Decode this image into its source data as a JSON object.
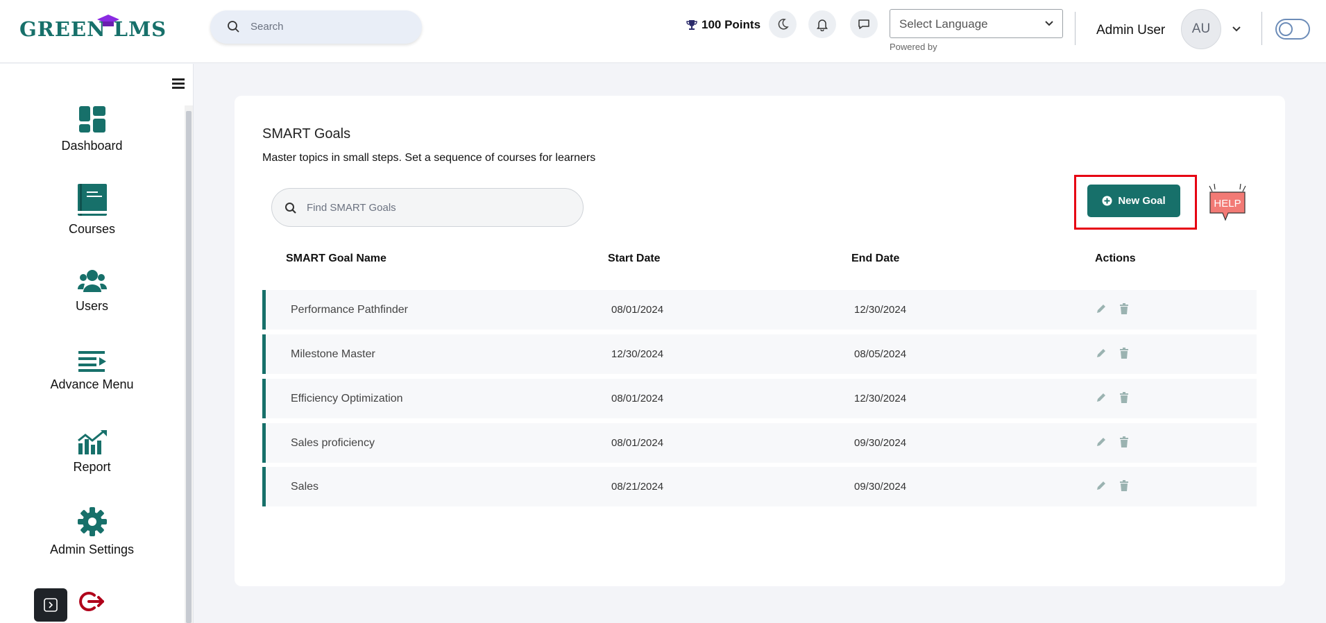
{
  "header": {
    "logo_text": "GREEN LMS",
    "search_placeholder": "Search",
    "points": "100 Points",
    "language_placeholder": "Select Language",
    "powered_by": "Powered by",
    "user_name": "Admin User",
    "avatar_initials": "AU"
  },
  "sidebar": {
    "items": [
      {
        "label": "Dashboard",
        "icon": "dashboard-icon"
      },
      {
        "label": "Courses",
        "icon": "book-icon"
      },
      {
        "label": "Users",
        "icon": "users-icon"
      },
      {
        "label": "Advance Menu",
        "icon": "menu-arrow-icon"
      },
      {
        "label": "Report",
        "icon": "chart-icon"
      },
      {
        "label": "Admin Settings",
        "icon": "gear-icon"
      }
    ]
  },
  "main": {
    "title": "SMART Goals",
    "subtitle": "Master topics in small steps. Set a sequence of courses for learners",
    "find_placeholder": "Find SMART Goals",
    "new_goal_label": "New Goal",
    "help_label": "HELP",
    "columns": [
      "SMART Goal Name",
      "Start Date",
      "End Date",
      "Actions"
    ],
    "rows": [
      {
        "name": "Performance Pathfinder",
        "start": "08/01/2024",
        "end": "12/30/2024"
      },
      {
        "name": "Milestone Master",
        "start": "12/30/2024",
        "end": "08/05/2024"
      },
      {
        "name": "Efficiency Optimization",
        "start": "08/01/2024",
        "end": "12/30/2024"
      },
      {
        "name": "Sales proficiency",
        "start": "08/01/2024",
        "end": "09/30/2024"
      },
      {
        "name": "Sales",
        "start": "08/21/2024",
        "end": "09/30/2024"
      }
    ]
  },
  "colors": {
    "brand": "#17706a",
    "highlight": "#e60012"
  }
}
